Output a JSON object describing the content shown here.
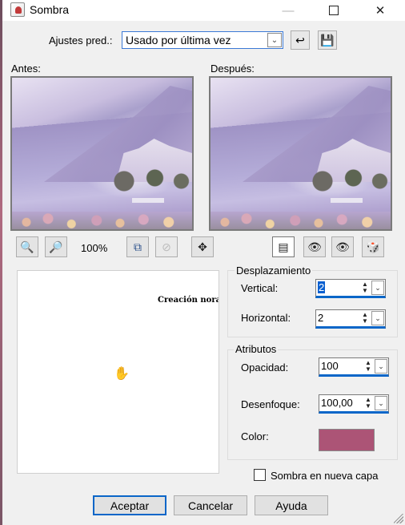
{
  "window": {
    "title": "Sombra"
  },
  "presets": {
    "label": "Ajustes pred.:",
    "value": "Usado por última vez"
  },
  "preview": {
    "before_label": "Antes:",
    "after_label": "Después:",
    "zoom": "100%"
  },
  "canvas": {
    "text": "Creación norai"
  },
  "offset": {
    "title": "Desplazamiento",
    "vertical_label": "Vertical:",
    "vertical_value": "2",
    "horizontal_label": "Horizontal:",
    "horizontal_value": "2"
  },
  "attributes": {
    "title": "Atributos",
    "opacity_label": "Opacidad:",
    "opacity_value": "100",
    "blur_label": "Desenfoque:",
    "blur_value": "100,00",
    "color_label": "Color:",
    "color_hex": "#ac5476"
  },
  "new_layer": {
    "label": "Sombra en nueva capa",
    "checked": false
  },
  "buttons": {
    "ok": "Aceptar",
    "cancel": "Cancelar",
    "help": "Ayuda"
  },
  "icons": {
    "app": "app-icon",
    "minimize": "minimize-icon",
    "maximize": "maximize-icon",
    "close": "close-icon",
    "reset": "reset-icon",
    "save": "save-icon",
    "zoom_out": "zoom-out-icon",
    "zoom_in": "zoom-in-icon",
    "fit": "fit-icon",
    "disabled": "hide-icon",
    "pan": "move-icon",
    "proof": "proof-icon",
    "auto_proof": "auto-proof-icon",
    "randomize": "randomize-icon"
  }
}
